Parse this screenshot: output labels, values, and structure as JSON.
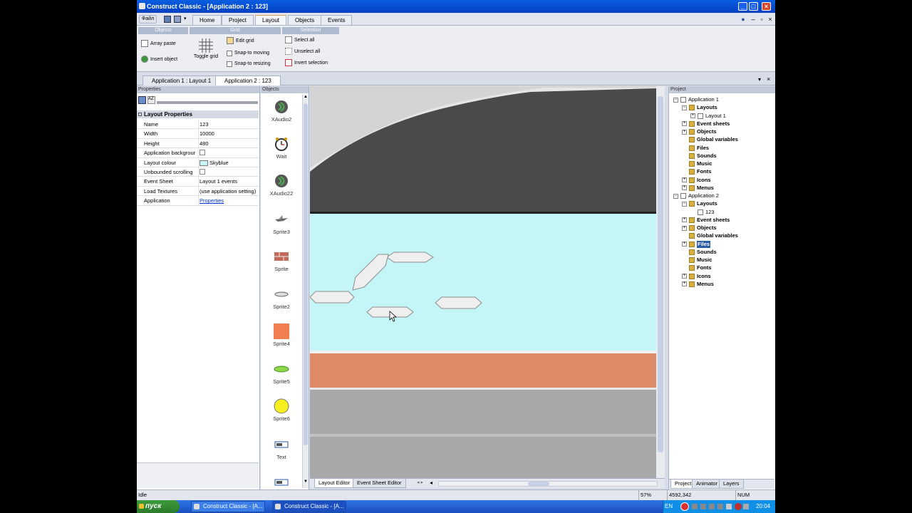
{
  "window": {
    "title": "Construct Classic - [Application 2 : 123]"
  },
  "quick_access": {
    "menu_label": "Файл"
  },
  "ribbon_tabs": [
    {
      "label": "Home"
    },
    {
      "label": "Project"
    },
    {
      "label": "Layout",
      "active": true
    },
    {
      "label": "Objects"
    },
    {
      "label": "Events"
    }
  ],
  "ribbon": {
    "groups": [
      "Objects",
      "Grid",
      "Selection"
    ],
    "objects": {
      "array_paste": "Array paste",
      "insert_object": "Insert object"
    },
    "grid": {
      "toggle_grid": "Toggle grid",
      "edit_grid": "Edit grid",
      "snap_moving": "Snap-to moving",
      "snap_resizing": "Snap-to resizing"
    },
    "selection": {
      "select_all": "Select all",
      "unselect_all": "Unselect all",
      "invert": "Invert selection"
    }
  },
  "doc_tabs": [
    {
      "label": "Application 1 : Layout 1"
    },
    {
      "label": "Application 2 : 123",
      "active": true
    }
  ],
  "properties": {
    "header": "Properties",
    "group": "Layout Properties",
    "rows": [
      {
        "key": "Name",
        "value": "123"
      },
      {
        "key": "Width",
        "value": "10000"
      },
      {
        "key": "Height",
        "value": "480"
      },
      {
        "key": "Application backgrour",
        "value": ""
      },
      {
        "key": "Layout colour",
        "value": "Skyblue"
      },
      {
        "key": "Unbounded scrolling",
        "value": ""
      },
      {
        "key": "Event Sheet",
        "value": "Layout 1 events"
      },
      {
        "key": "Load Textures",
        "value": "(use application setting)"
      },
      {
        "key": "Application",
        "value": "Properties"
      }
    ]
  },
  "objects_panel": {
    "header": "Objects",
    "items": [
      {
        "label": "XAudio2",
        "icon": "speaker-icon"
      },
      {
        "label": "Wait",
        "icon": "clock-icon"
      },
      {
        "label": "XAudio22",
        "icon": "speaker-icon"
      },
      {
        "label": "Sprite3",
        "icon": "plane-sprite-icon"
      },
      {
        "label": "Sprite",
        "icon": "brick-sprite-icon"
      },
      {
        "label": "Sprite2",
        "icon": "platform-sprite-icon"
      },
      {
        "label": "Sprite4",
        "icon": "orange-square-icon"
      },
      {
        "label": "Sprite5",
        "icon": "green-bar-icon"
      },
      {
        "label": "Sprite6",
        "icon": "yellow-circle-icon"
      },
      {
        "label": "Text",
        "icon": "text-object-icon"
      }
    ]
  },
  "layout_colors": {
    "sky": "#c4f6f8",
    "ground": "#df8a66",
    "mountain": "#4a4a4a",
    "hill_bg": "#c8c8c8"
  },
  "bottom_tabs": [
    {
      "label": "Layout Editor",
      "active": true
    },
    {
      "label": "Event Sheet Editor"
    }
  ],
  "project_panel": {
    "header": "Project",
    "tree": [
      {
        "label": "Application 1",
        "level": 0,
        "type": "app",
        "box": "-"
      },
      {
        "label": "Layouts",
        "level": 1,
        "type": "folder",
        "box": "-",
        "bold": true
      },
      {
        "label": "Layout 1",
        "level": 2,
        "type": "file",
        "box": "+"
      },
      {
        "label": "Event sheets",
        "level": 1,
        "type": "folder",
        "box": "+",
        "bold": true
      },
      {
        "label": "Objects",
        "level": 1,
        "type": "folder",
        "box": "+",
        "bold": true
      },
      {
        "label": "Global variables",
        "level": 1,
        "type": "folder",
        "box": "",
        "bold": true
      },
      {
        "label": "Files",
        "level": 1,
        "type": "folder",
        "box": "",
        "bold": true
      },
      {
        "label": "Sounds",
        "level": 1,
        "type": "folder",
        "box": "",
        "bold": true
      },
      {
        "label": "Music",
        "level": 1,
        "type": "folder",
        "box": "",
        "bold": true
      },
      {
        "label": "Fonts",
        "level": 1,
        "type": "folder",
        "box": "",
        "bold": true
      },
      {
        "label": "Icons",
        "level": 1,
        "type": "folder",
        "box": "+",
        "bold": true
      },
      {
        "label": "Menus",
        "level": 1,
        "type": "folder",
        "box": "+",
        "bold": true
      },
      {
        "label": "Application 2",
        "level": 0,
        "type": "app",
        "box": "-"
      },
      {
        "label": "Layouts",
        "level": 1,
        "type": "folder",
        "box": "-",
        "bold": true
      },
      {
        "label": "123",
        "level": 2,
        "type": "file",
        "box": ""
      },
      {
        "label": "Event sheets",
        "level": 1,
        "type": "folder",
        "box": "+",
        "bold": true
      },
      {
        "label": "Objects",
        "level": 1,
        "type": "folder",
        "box": "+",
        "bold": true
      },
      {
        "label": "Global variables",
        "level": 1,
        "type": "folder",
        "box": "",
        "bold": true
      },
      {
        "label": "Files",
        "level": 1,
        "type": "folder",
        "box": "+",
        "bold": true,
        "selected": true
      },
      {
        "label": "Sounds",
        "level": 1,
        "type": "folder",
        "box": "",
        "bold": true
      },
      {
        "label": "Music",
        "level": 1,
        "type": "folder",
        "box": "",
        "bold": true
      },
      {
        "label": "Fonts",
        "level": 1,
        "type": "folder",
        "box": "",
        "bold": true
      },
      {
        "label": "Icons",
        "level": 1,
        "type": "folder",
        "box": "+",
        "bold": true
      },
      {
        "label": "Menus",
        "level": 1,
        "type": "folder",
        "box": "+",
        "bold": true
      }
    ],
    "tabs": [
      {
        "label": "Project",
        "active": true
      },
      {
        "label": "Animator"
      },
      {
        "label": "Layers"
      }
    ]
  },
  "status": {
    "left": "Idle",
    "zoom": "57%",
    "coords": "4592,342",
    "num": "NUM"
  },
  "taskbar": {
    "start": "пуск",
    "tasks": [
      "Construct Classic - [A...",
      "Construct Classic - [A..."
    ],
    "lang": "EN",
    "clock": "20:04"
  }
}
